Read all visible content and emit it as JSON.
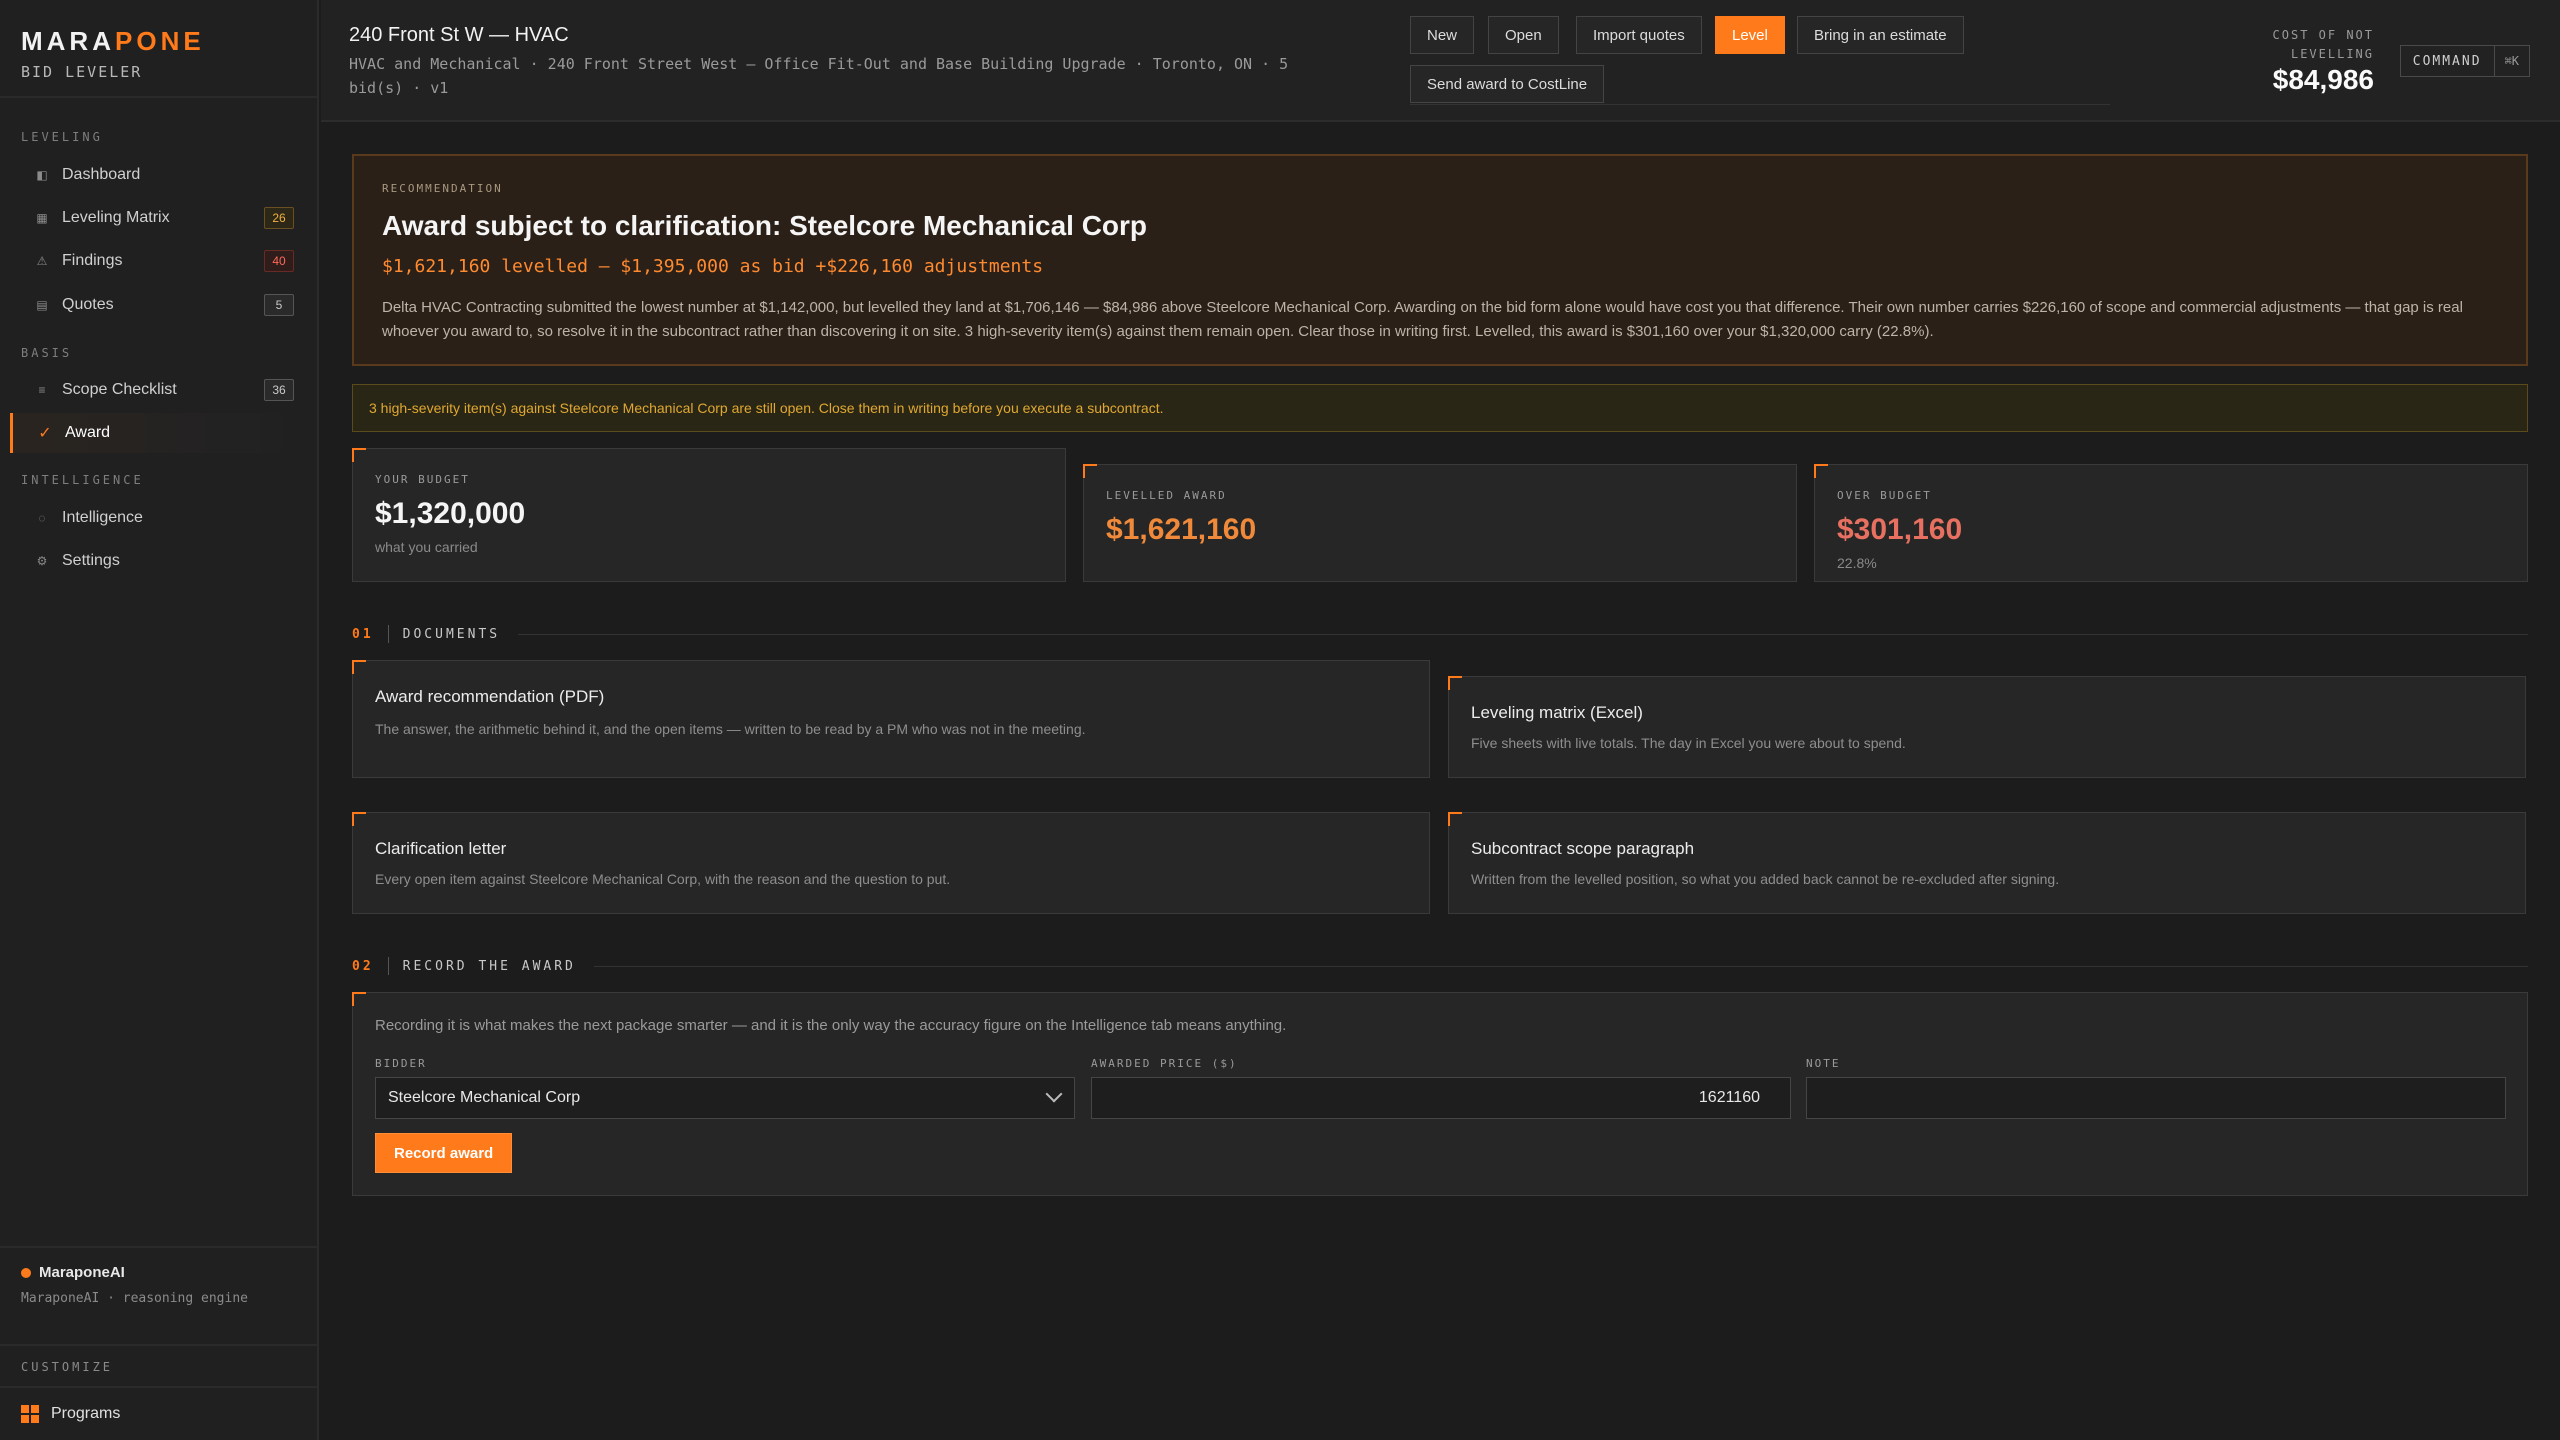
{
  "brand": {
    "name_part1": "MARA",
    "name_part2": "PONE",
    "subtitle": "BID LEVELER"
  },
  "sidebar": {
    "sections": {
      "leveling": "LEVELING",
      "basis": "BASIS",
      "intelligence": "INTELLIGENCE"
    },
    "items": [
      {
        "label": "Dashboard",
        "icon": "dashboard-icon",
        "badge": ""
      },
      {
        "label": "Leveling Matrix",
        "icon": "matrix-icon",
        "badge": "26"
      },
      {
        "label": "Findings",
        "icon": "warning-icon",
        "badge": "40"
      },
      {
        "label": "Quotes",
        "icon": "quotes-icon",
        "badge": "5"
      },
      {
        "label": "Scope Checklist",
        "icon": "list-icon",
        "badge": "36"
      },
      {
        "label": "Award",
        "icon": "check-icon",
        "badge": ""
      },
      {
        "label": "Intelligence",
        "icon": "circle-icon",
        "badge": ""
      },
      {
        "label": "Settings",
        "icon": "gear-icon",
        "badge": ""
      }
    ],
    "ai": {
      "name": "MaraponeAI",
      "sub": "MaraponeAI · reasoning engine"
    },
    "customize": "CUSTOMIZE",
    "programs": "Programs"
  },
  "header": {
    "title": "240 Front St W — HVAC",
    "subtitle": "HVAC and Mechanical · 240 Front Street West — Office Fit-Out and Base Building Upgrade · Toronto, ON · 5 bid(s) · v1",
    "buttons": {
      "new": "New",
      "open": "Open",
      "import": "Import quotes",
      "level": "Level",
      "estimate": "Bring in an estimate",
      "send": "Send award to CostLine"
    },
    "cost_label": "COST OF NOT LEVELLING",
    "cost_value": "$84,986",
    "command": "COMMAND",
    "command_shortcut": "⌘K"
  },
  "recommendation": {
    "label": "RECOMMENDATION",
    "title": "Award subject to clarification: Steelcore Mechanical Corp",
    "summary": "$1,621,160 levelled — $1,395,000 as bid +$226,160 adjustments",
    "body": "Delta HVAC Contracting submitted the lowest number at $1,142,000, but levelled they land at $1,706,146 — $84,986 above Steelcore Mechanical Corp. Awarding on the bid form alone would have cost you that difference. Their own number carries $226,160 of scope and commercial adjustments — that gap is real whoever you award to, so resolve it in the subcontract rather than discovering it on site. 3 high-severity item(s) against them remain open. Clear those in writing first. Levelled, this award is $301,160 over your $1,320,000 carry (22.8%)."
  },
  "warning": "3 high-severity item(s) against Steelcore Mechanical Corp are still open. Close them in writing before you execute a subcontract.",
  "stats": {
    "budget": {
      "label": "YOUR BUDGET",
      "value": "$1,320,000",
      "note": "what you carried"
    },
    "levelled": {
      "label": "LEVELLED AWARD",
      "value": "$1,621,160"
    },
    "over": {
      "label": "OVER BUDGET",
      "value": "$301,160",
      "note": "22.8%"
    }
  },
  "documents": {
    "num": "01",
    "title": "DOCUMENTS",
    "items": [
      {
        "title": "Award recommendation (PDF)",
        "desc": "The answer, the arithmetic behind it, and the open items — written to be read by a PM who was not in the meeting."
      },
      {
        "title": "Leveling matrix (Excel)",
        "desc": "Five sheets with live totals. The day in Excel you were about to spend."
      },
      {
        "title": "Clarification letter",
        "desc": "Every open item against Steelcore Mechanical Corp, with the reason and the question to put."
      },
      {
        "title": "Subcontract scope paragraph",
        "desc": "Written from the levelled position, so what you added back cannot be re-excluded after signing."
      }
    ]
  },
  "record": {
    "num": "02",
    "title": "RECORD THE AWARD",
    "intro": "Recording it is what makes the next package smarter — and it is the only way the accuracy figure on the Intelligence tab means anything.",
    "bidder_label": "BIDDER",
    "bidder_value": "Steelcore Mechanical Corp",
    "price_label": "AWARDED PRICE ($)",
    "price_value": "1621160",
    "note_label": "NOTE",
    "note_value": "",
    "button": "Record award"
  },
  "colors": {
    "accent": "#ff7a1a",
    "background": "#1c1c1c",
    "warning": "#e0a830"
  }
}
